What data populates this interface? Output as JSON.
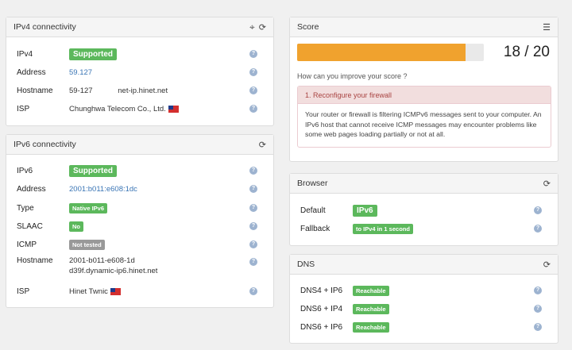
{
  "ipv4": {
    "title": "IPv4 connectivity",
    "rows": [
      {
        "label": "IPv4",
        "badge": "Supported"
      },
      {
        "label": "Address",
        "value": "59.127"
      },
      {
        "label": "Hostname",
        "value": "59-127            net-ip.hinet.net"
      },
      {
        "label": "ISP",
        "value": "Chunghwa Telecom Co., Ltd."
      }
    ]
  },
  "ipv6": {
    "title": "IPv6 connectivity",
    "rows": [
      {
        "label": "IPv6",
        "badge": "Supported"
      },
      {
        "label": "Address",
        "value": "2001:b011:e608:1dc"
      },
      {
        "label": "Type",
        "badge": "Native IPv6"
      },
      {
        "label": "SLAAC",
        "badge": "No"
      },
      {
        "label": "ICMP",
        "badge": "Not tested"
      },
      {
        "label": "Hostname",
        "value": "2001-b011-e608-1d",
        "value2": "d39f.dynamic-ip6.hinet.net"
      },
      {
        "label": "ISP",
        "value": "Hinet Twnic"
      }
    ]
  },
  "score": {
    "title": "Score",
    "value": "18 / 20",
    "progress": 0.9,
    "improve_text": "How can you improve your score ?",
    "tip_title": "1. Reconfigure your firewall",
    "tip_body": "Your router or firewall is filtering ICMPv6 messages sent to your computer. An IPv6 host that cannot receive ICMP messages may encounter problems like some web pages loading partially or not at all."
  },
  "browser": {
    "title": "Browser",
    "rows": [
      {
        "label": "Default",
        "badge": "IPv6"
      },
      {
        "label": "Fallback",
        "badge": "to IPv4 in 1 second"
      }
    ]
  },
  "dns": {
    "title": "DNS",
    "rows": [
      {
        "label": "DNS4 + IP6",
        "badge": "Reachable"
      },
      {
        "label": "DNS6 + IP4",
        "badge": "Reachable"
      },
      {
        "label": "DNS6 + IP6",
        "badge": "Reachable"
      }
    ]
  },
  "colors": {
    "success": "#5cb85c",
    "muted": "#999999",
    "progress": "#f0a22e",
    "danger_bg": "#f2dede",
    "link": "#3a75b5"
  },
  "icons": {
    "help": "question-circle-icon",
    "refresh": "refresh-icon",
    "list": "list-icon",
    "crosshair": "crosshair-icon",
    "flag": "taiwan-flag-icon"
  }
}
